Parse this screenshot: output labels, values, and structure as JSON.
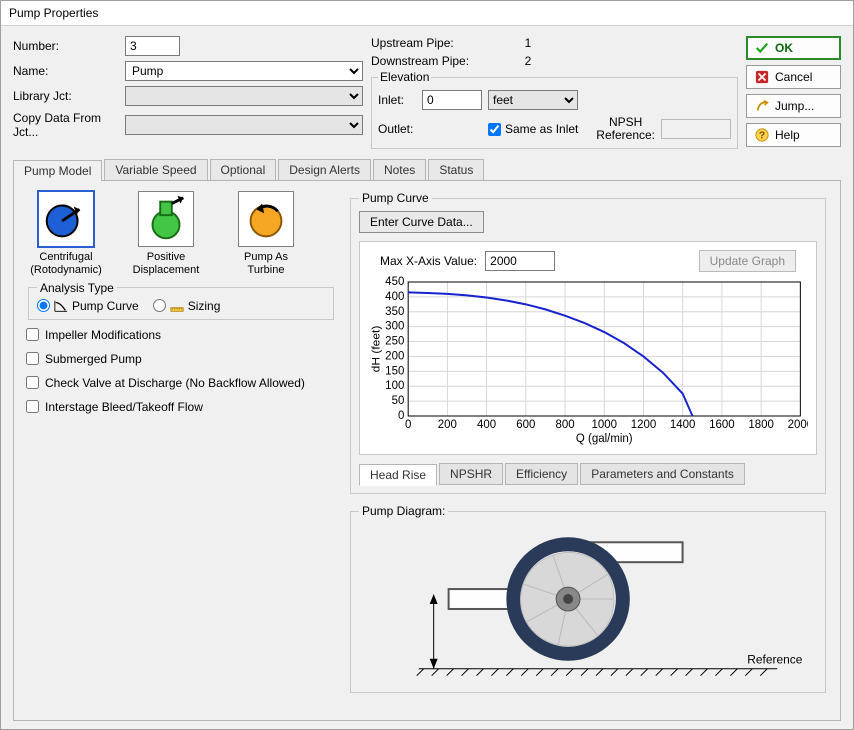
{
  "window_title": "Pump Properties",
  "labels": {
    "number": "Number:",
    "name": "Name:",
    "library_jct": "Library Jct:",
    "copy_from": "Copy Data From Jct...",
    "up_pipe": "Upstream Pipe:",
    "down_pipe": "Downstream Pipe:",
    "elevation": "Elevation",
    "inlet": "Inlet:",
    "outlet": "Outlet:",
    "same_as_inlet": "Same as Inlet",
    "npsh_ref": "NPSH Reference:",
    "analysis_type": "Analysis Type",
    "pump_curve_radio": "Pump Curve",
    "sizing_radio": "Sizing",
    "impeller_mod": "Impeller Modifications",
    "submerged_pump": "Submerged Pump",
    "check_valve": "Check Valve at Discharge (No Backflow Allowed)",
    "interstage": "Interstage Bleed/Takeoff Flow",
    "pump_curve_group": "Pump Curve",
    "enter_curve": "Enter Curve Data...",
    "max_x": "Max X-Axis Value:",
    "update_graph": "Update Graph",
    "pump_diagram": "Pump Diagram:",
    "reference_line": "Reference"
  },
  "values": {
    "number": "3",
    "name": "Pump",
    "up_pipe_val": "1",
    "down_pipe_val": "2",
    "inlet_val": "0",
    "elev_unit_selected": "feet",
    "same_as_inlet_checked": true,
    "npsh_ref_val": "",
    "max_x_val": "2000"
  },
  "buttons": {
    "ok": "OK",
    "cancel": "Cancel",
    "jump": "Jump...",
    "help": "Help"
  },
  "tabs": [
    "Pump Model",
    "Variable Speed",
    "Optional",
    "Design Alerts",
    "Notes",
    "Status"
  ],
  "active_tab": 0,
  "pump_types": [
    {
      "id": "centrifugal",
      "label": "Centrifugal (Rotodynamic)"
    },
    {
      "id": "positive",
      "label": "Positive Displacement"
    },
    {
      "id": "turbine",
      "label": "Pump As Turbine"
    }
  ],
  "selected_pump_type": 0,
  "subtabs": [
    "Head Rise",
    "NPSHR",
    "Efficiency",
    "Parameters and Constants"
  ],
  "active_subtab": 0,
  "chart_data": {
    "type": "line",
    "title": "",
    "xlabel": "Q (gal/min)",
    "ylabel": "dH (feet)",
    "xlim": [
      0,
      2000
    ],
    "ylim": [
      0,
      450
    ],
    "x_ticks": [
      0,
      200,
      400,
      600,
      800,
      1000,
      1200,
      1400,
      1600,
      1800,
      2000
    ],
    "y_ticks": [
      0,
      50,
      100,
      150,
      200,
      250,
      300,
      350,
      400,
      450
    ],
    "series": [
      {
        "name": "Pump Curve",
        "x": [
          0,
          100,
          200,
          300,
          400,
          500,
          600,
          700,
          800,
          900,
          1000,
          1100,
          1200,
          1300,
          1400,
          1450
        ],
        "y": [
          415,
          413,
          410,
          405,
          398,
          388,
          375,
          358,
          337,
          312,
          282,
          245,
          200,
          145,
          75,
          0
        ],
        "color": "#1722cf"
      }
    ]
  }
}
